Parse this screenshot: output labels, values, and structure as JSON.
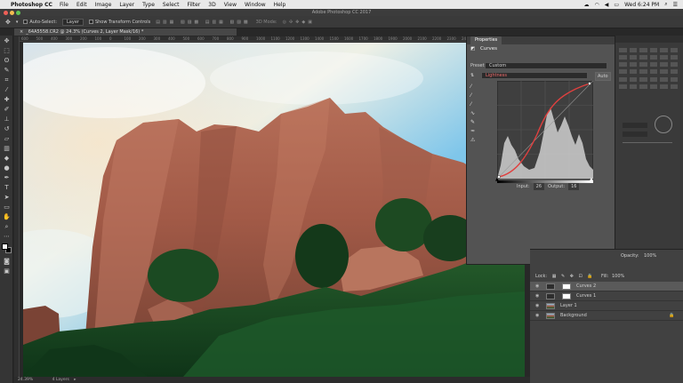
{
  "menubar": {
    "app_name": "Photoshop CC",
    "items": [
      "File",
      "Edit",
      "Image",
      "Layer",
      "Type",
      "Select",
      "Filter",
      "3D",
      "View",
      "Window",
      "Help"
    ],
    "clock": "Wed 6:24 PM"
  },
  "window": {
    "title": "Adobe Photoshop CC 2017"
  },
  "options_bar": {
    "auto_select_label": "Auto-Select:",
    "auto_select_value": "Layer",
    "transform_label": "Show Transform Controls",
    "mode_label": "3D Mode:"
  },
  "document": {
    "tab_title": "_64A5558.CR2 @ 24.3% (Curves 2, Layer Mask/16) *",
    "ruler_ticks": [
      "600",
      "500",
      "400",
      "300",
      "200",
      "100",
      "0",
      "100",
      "200",
      "300",
      "400",
      "500",
      "600",
      "700",
      "800",
      "900",
      "1000",
      "1100",
      "1200",
      "1300",
      "1400",
      "1500",
      "1600",
      "1700",
      "1800",
      "1900",
      "2000",
      "2100",
      "2200",
      "2300",
      "2400"
    ],
    "zoom": "24.39%",
    "status": "4 Layers"
  },
  "properties": {
    "tab_label": "Properties",
    "panel_title": "Curves",
    "preset_label": "Preset:",
    "preset_value": "Custom",
    "channel_value": "Lightness",
    "auto_label": "Auto",
    "input_label": "Input:",
    "input_value": "26",
    "output_label": "Output:",
    "output_value": "16",
    "curve_color": "#e0403f",
    "histogram_color": "#cfcfcf"
  },
  "layers": {
    "opacity_label": "Opacity:",
    "opacity_value": "100%",
    "lock_label": "Lock:",
    "fill_label": "Fill:",
    "fill_value": "100%",
    "items": [
      {
        "name": "Curves 2"
      },
      {
        "name": "Curves 1"
      },
      {
        "name": "Layer 1"
      },
      {
        "name": "Background"
      }
    ]
  }
}
